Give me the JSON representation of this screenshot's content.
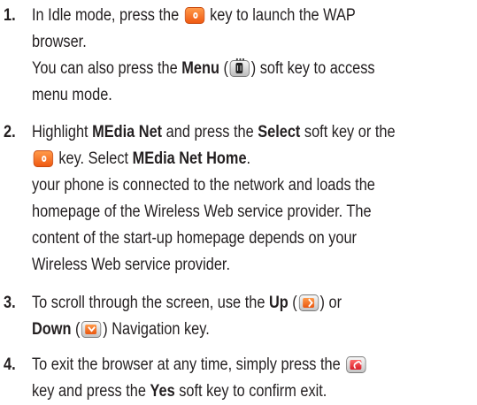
{
  "steps": [
    {
      "number": "1.",
      "lines": [
        [
          "In Idle mode, press the ",
          "[send-key]",
          " key to launch the WAP"
        ],
        [
          "browser."
        ],
        [
          "You can also press the ",
          "**Menu**",
          " (",
          "[menu-key]",
          ") soft key to access"
        ],
        [
          "menu mode."
        ]
      ]
    },
    {
      "number": "2.",
      "lines": [
        [
          "Highlight ",
          "**MEdia Net**",
          " and press the ",
          "**Select**",
          " soft key or the"
        ],
        [
          "[send-key]",
          " key. Select ",
          "**MEdia Net Home**",
          "."
        ],
        [
          "your phone is connected to the network and loads the"
        ],
        [
          "homepage of the Wireless Web service provider. The"
        ],
        [
          "content of the start-up homepage depends on your"
        ],
        [
          "Wireless Web service provider."
        ]
      ]
    },
    {
      "number": "3.",
      "lines": [
        [
          "To scroll through the screen, use the ",
          "**Up**",
          " (",
          "[up-key]",
          ") or"
        ],
        [
          "**Down**",
          " (",
          "[down-key]",
          ") Navigation key."
        ]
      ]
    },
    {
      "number": "4.",
      "lines": [
        [
          "To exit the browser at any time, simply press the ",
          "[end-key]"
        ],
        [
          "key and press the ",
          "**Yes**",
          " soft key to confirm exit."
        ]
      ]
    }
  ],
  "icons": {
    "send-key": "orange-send-key-icon",
    "menu-key": "menu-soft-key-icon",
    "up-key": "navigation-up-key-icon",
    "down-key": "navigation-down-key-icon",
    "end-key": "end-key-icon"
  },
  "colors": {
    "text": "#231f20",
    "send_key": "#f26522",
    "end_key": "#e31b23"
  }
}
